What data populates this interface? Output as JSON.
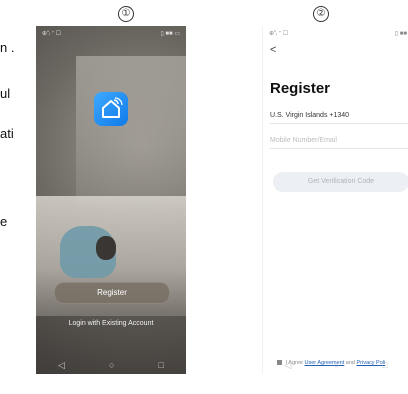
{
  "margin": {
    "line1": "n .",
    "line2": "ul",
    "line3": "ati",
    "line4": "e"
  },
  "labels": {
    "step1": "①",
    "step2": "②"
  },
  "phone1": {
    "status_left": "⊕\"ᵢ ᐩ ☐",
    "status_right": "▯ ■■ ▭",
    "register_label": "Register",
    "login_label": "Login with Existing Account",
    "nav_back": "◁",
    "nav_home": "○",
    "nav_recent": "□"
  },
  "phone2": {
    "status_left": "⊕\"ᵢ ᐩ ☐",
    "status_right": "▯ ■■",
    "back": "<",
    "title": "Register",
    "country": "U.S. Virgin Islands +1340",
    "mobile_placeholder": "Mobile Number/Email",
    "verify_label": "Get Verification Code",
    "agree_prefix": "I Agree",
    "agree_link1": "User Agreement",
    "agree_mid": "and",
    "agree_link2": "Privacy Poli",
    "nav_back": "◁",
    "nav_home": "○",
    "nav_recent": "□"
  }
}
